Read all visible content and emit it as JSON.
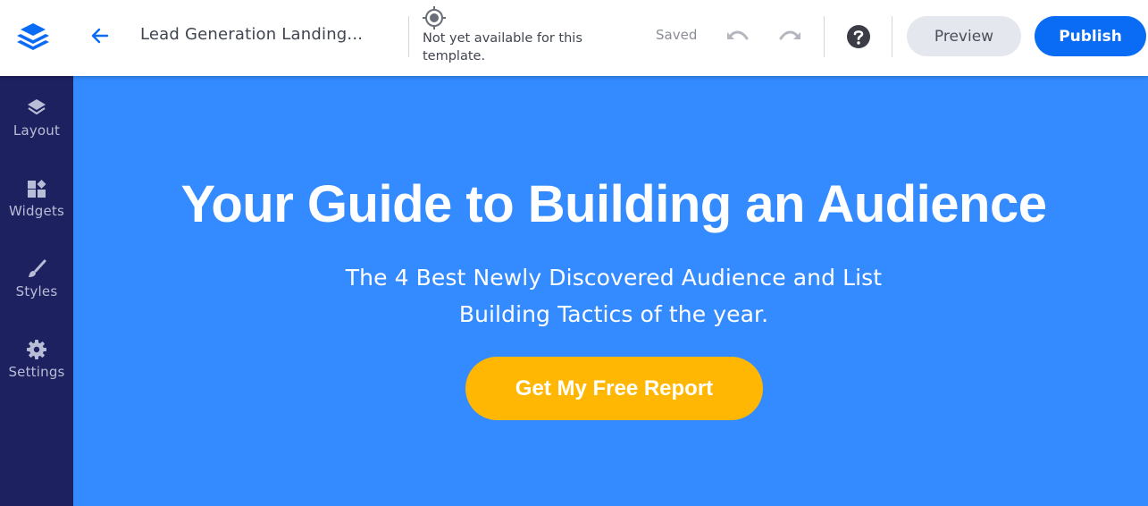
{
  "header": {
    "logo_icon": "layers-logo-icon",
    "back_icon": "arrow-left-icon",
    "page_title": "Lead Generation Landing...",
    "target_icon": "crosshair-target-icon",
    "notice_text": "Not yet available for this template.",
    "save_status": "Saved",
    "undo_icon": "undo-icon",
    "redo_icon": "redo-icon",
    "help_icon": "question-circle-icon",
    "preview_label": "Preview",
    "publish_label": "Publish"
  },
  "sidebar": {
    "items": [
      {
        "label": "Layout",
        "icon": "layers-icon"
      },
      {
        "label": "Widgets",
        "icon": "widgets-icon"
      },
      {
        "label": "Styles",
        "icon": "brush-icon"
      },
      {
        "label": "Settings",
        "icon": "gear-icon"
      }
    ]
  },
  "canvas": {
    "headline": "Your Guide to Building an Audience",
    "subheadline_line1": "The 4 Best Newly Discovered Audience and List",
    "subheadline_line2": "Building Tactics of the year.",
    "cta_label": "Get My Free Report"
  },
  "colors": {
    "brand_blue": "#0a6cf5",
    "sidebar_bg": "#1e2160",
    "canvas_bg": "#348bff",
    "cta_bg": "#ffb703",
    "preview_bg": "#e4e7ee"
  }
}
